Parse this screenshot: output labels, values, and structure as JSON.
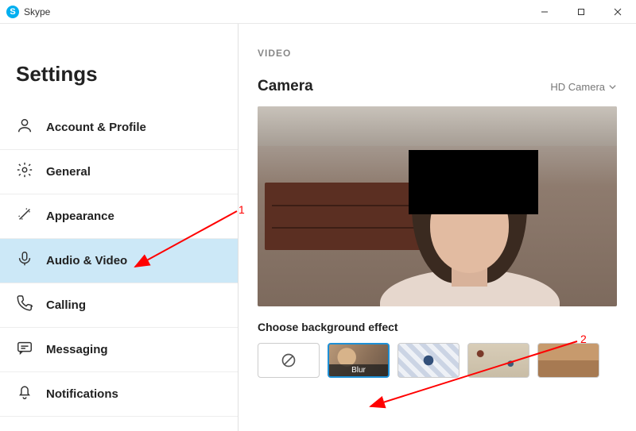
{
  "titlebar": {
    "app_name": "Skype"
  },
  "sidebar": {
    "title": "Settings",
    "items": [
      {
        "label": "Account & Profile",
        "icon": "user-icon"
      },
      {
        "label": "General",
        "icon": "gear-icon"
      },
      {
        "label": "Appearance",
        "icon": "wand-icon"
      },
      {
        "label": "Audio & Video",
        "icon": "mic-icon"
      },
      {
        "label": "Calling",
        "icon": "phone-icon"
      },
      {
        "label": "Messaging",
        "icon": "message-icon"
      },
      {
        "label": "Notifications",
        "icon": "bell-icon"
      }
    ],
    "active_index": 3
  },
  "main": {
    "section_label": "VIDEO",
    "camera_title": "Camera",
    "camera_selected": "HD Camera",
    "effect_title": "Choose background effect",
    "effects": [
      {
        "name": "none",
        "caption": ""
      },
      {
        "name": "blur",
        "caption": "Blur",
        "selected": true
      },
      {
        "name": "pattern1",
        "caption": ""
      },
      {
        "name": "pattern2",
        "caption": ""
      },
      {
        "name": "pattern3",
        "caption": ""
      }
    ]
  },
  "annotations": {
    "label1": "1",
    "label2": "2"
  }
}
